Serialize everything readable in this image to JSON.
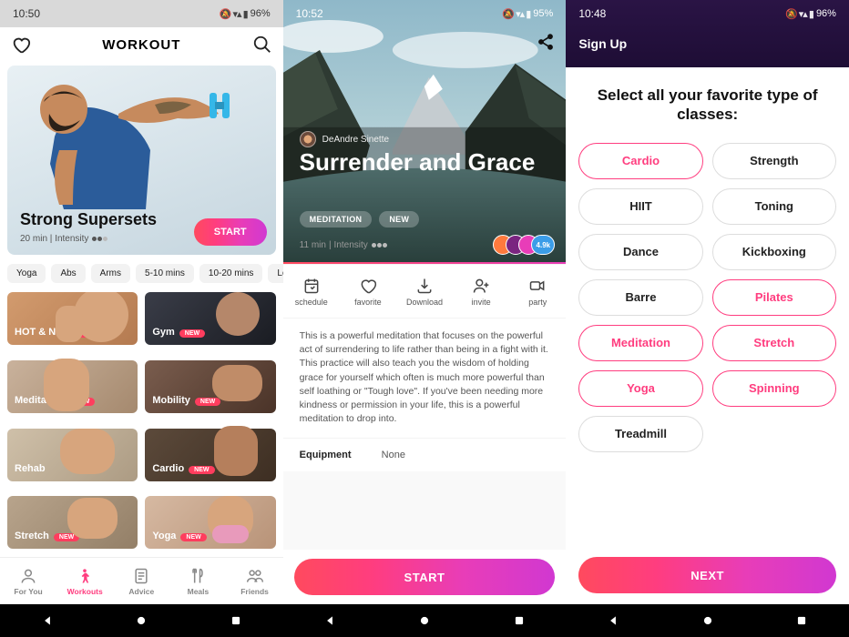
{
  "screen1": {
    "status": {
      "time": "10:50",
      "battery": "96%"
    },
    "header": {
      "title": "WORKOUT"
    },
    "hero": {
      "title": "Strong Supersets",
      "duration": "20 min",
      "intensity_label": "Intensity",
      "start_label": "START"
    },
    "tags": [
      "Yoga",
      "Abs",
      "Arms",
      "5-10 mins",
      "10-20 mins",
      "Low intensity"
    ],
    "categories": [
      {
        "label": "HOT & NEW",
        "new": true
      },
      {
        "label": "Gym",
        "new": true
      },
      {
        "label": "Meditation",
        "new": true
      },
      {
        "label": "Mobility",
        "new": true
      },
      {
        "label": "Rehab",
        "new": false
      },
      {
        "label": "Cardio",
        "new": true
      },
      {
        "label": "Stretch",
        "new": true
      },
      {
        "label": "Yoga",
        "new": true
      }
    ],
    "new_badge": "NEW",
    "nav": {
      "for_you": "For You",
      "workouts": "Workouts",
      "advice": "Advice",
      "meals": "Meals",
      "friends": "Friends"
    }
  },
  "screen2": {
    "status": {
      "time": "10:52",
      "battery": "95%"
    },
    "author": "DeAndre Sinette",
    "title": "Surrender and Grace",
    "chips": {
      "meditation": "MEDITATION",
      "new": "NEW"
    },
    "meta": {
      "duration": "11 min",
      "intensity_label": "Intensity"
    },
    "participants_count": "4.9k",
    "actions": {
      "schedule": "schedule",
      "favorite": "favorite",
      "download": "Download",
      "invite": "invite",
      "party": "party"
    },
    "description": "This is a powerful meditation that focuses on the powerful act of surrendering to life rather than being in a fight with it. This practice will also teach you the wisdom of holding grace for yourself which often is much more powerful than self loathing or \"Tough love\". If you've been needing more kindness or permission in your life, this is a powerful meditation to drop into.",
    "equipment": {
      "label": "Equipment",
      "value": "None"
    },
    "start_label": "START"
  },
  "screen3": {
    "status": {
      "time": "10:48",
      "battery": "96%"
    },
    "signup": "Sign Up",
    "heading": "Select all your favorite type of classes:",
    "classes": [
      {
        "label": "Cardio",
        "selected": true
      },
      {
        "label": "Strength",
        "selected": false
      },
      {
        "label": "HIIT",
        "selected": false
      },
      {
        "label": "Toning",
        "selected": false
      },
      {
        "label": "Dance",
        "selected": false
      },
      {
        "label": "Kickboxing",
        "selected": false
      },
      {
        "label": "Barre",
        "selected": false
      },
      {
        "label": "Pilates",
        "selected": true
      },
      {
        "label": "Meditation",
        "selected": true
      },
      {
        "label": "Stretch",
        "selected": true
      },
      {
        "label": "Yoga",
        "selected": true
      },
      {
        "label": "Spinning",
        "selected": true
      },
      {
        "label": "Treadmill",
        "selected": false
      }
    ],
    "next_label": "NEXT"
  }
}
